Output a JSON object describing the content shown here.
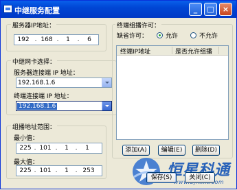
{
  "window": {
    "title": "中继服务配置",
    "min_icon": "minimize-icon",
    "max_icon": "maximize-icon",
    "close_icon": "close-icon"
  },
  "server_ip": {
    "label": "服务器IP地址：",
    "octets": [
      "192",
      "168",
      "1",
      "6"
    ]
  },
  "nic": {
    "group_label": "中继网卡选择：",
    "server_side_label": "服务器连接端 IP 地址：",
    "server_side_value": "192.168.1.6",
    "terminal_side_label": "终端连接端 IP 地址：",
    "terminal_side_value": "192.168.1.6"
  },
  "multicast_range": {
    "group_label": "组播地址范围：",
    "min_label": "最小值：",
    "min_octets": [
      "225",
      "101",
      "1",
      "1"
    ],
    "max_label": "最大值：",
    "max_octets": [
      "225",
      "101",
      "1",
      "253"
    ]
  },
  "terminal_permit": {
    "group_label": "终端组播许可：",
    "default_label": "缺省许可：",
    "allow_label": "允许",
    "deny_label": "不允许",
    "selected": "允许",
    "columns": [
      "终端IP地址",
      "是否允许组播"
    ],
    "rows": [],
    "add_button": "添加(A)",
    "edit_button": "编辑(E)",
    "delete_button": "删除(D)"
  },
  "footer": {
    "save_button": "保存(S)",
    "close_button": "关闭(C)"
  },
  "watermark": {
    "brand": "恒星科通",
    "url": "www.bjhxkt.com"
  },
  "colors": {
    "titlebar": "#0046D5",
    "face": "#ECE9D8",
    "selection": "#316AC5"
  }
}
